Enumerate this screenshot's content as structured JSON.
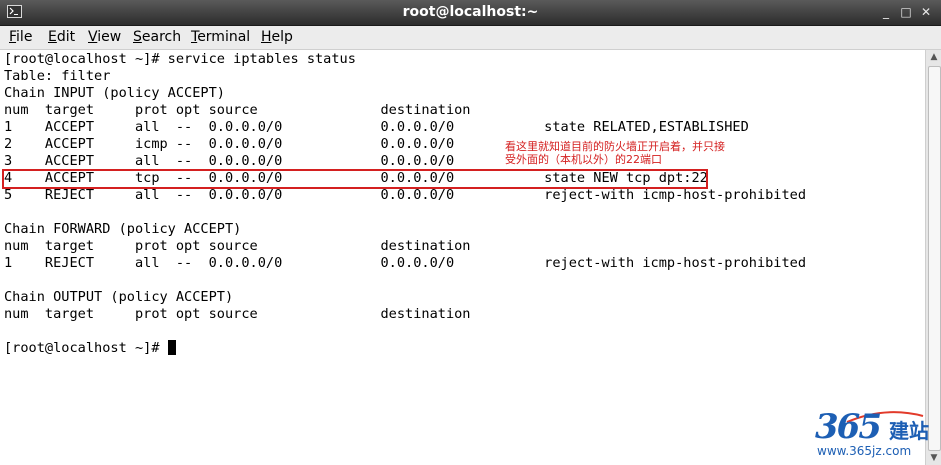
{
  "window": {
    "title": "root@localhost:~",
    "minimize_glyph": "_",
    "maximize_glyph": "□",
    "close_glyph": "✕"
  },
  "menu": {
    "items": [
      {
        "label": "File",
        "mnemonic": "F",
        "rest": "ile"
      },
      {
        "label": "Edit",
        "mnemonic": "E",
        "rest": "dit"
      },
      {
        "label": "View",
        "mnemonic": "V",
        "rest": "iew"
      },
      {
        "label": "Search",
        "mnemonic": "S",
        "rest": "earch"
      },
      {
        "label": "Terminal",
        "mnemonic": "T",
        "rest": "erminal"
      },
      {
        "label": "Help",
        "mnemonic": "H",
        "rest": "elp"
      }
    ]
  },
  "terminal": {
    "lines": [
      "[root@localhost ~]# service iptables status",
      "Table: filter",
      "Chain INPUT (policy ACCEPT)",
      "num  target     prot opt source               destination",
      "1    ACCEPT     all  --  0.0.0.0/0            0.0.0.0/0           state RELATED,ESTABLISHED",
      "2    ACCEPT     icmp --  0.0.0.0/0            0.0.0.0/0",
      "3    ACCEPT     all  --  0.0.0.0/0            0.0.0.0/0",
      "4    ACCEPT     tcp  --  0.0.0.0/0            0.0.0.0/0           state NEW tcp dpt:22",
      "5    REJECT     all  --  0.0.0.0/0            0.0.0.0/0           reject-with icmp-host-prohibited",
      "",
      "Chain FORWARD (policy ACCEPT)",
      "num  target     prot opt source               destination",
      "1    REJECT     all  --  0.0.0.0/0            0.0.0.0/0           reject-with icmp-host-prohibited",
      "",
      "Chain OUTPUT (policy ACCEPT)",
      "num  target     prot opt source               destination",
      "",
      "[root@localhost ~]# "
    ]
  },
  "annotation": {
    "line1": "看这里就知道目前的防火墙正开启着，并只接",
    "line2": "受外面的（本机以外）的22端口"
  },
  "watermark": {
    "logo": "365",
    "cn": "建站",
    "url": "www.365jz.com"
  },
  "colors": {
    "annotation": "#d42020",
    "titlebar": "#3a3a3a",
    "logo_blue": "#1d5fb4",
    "logo_red": "#e23a2a"
  }
}
